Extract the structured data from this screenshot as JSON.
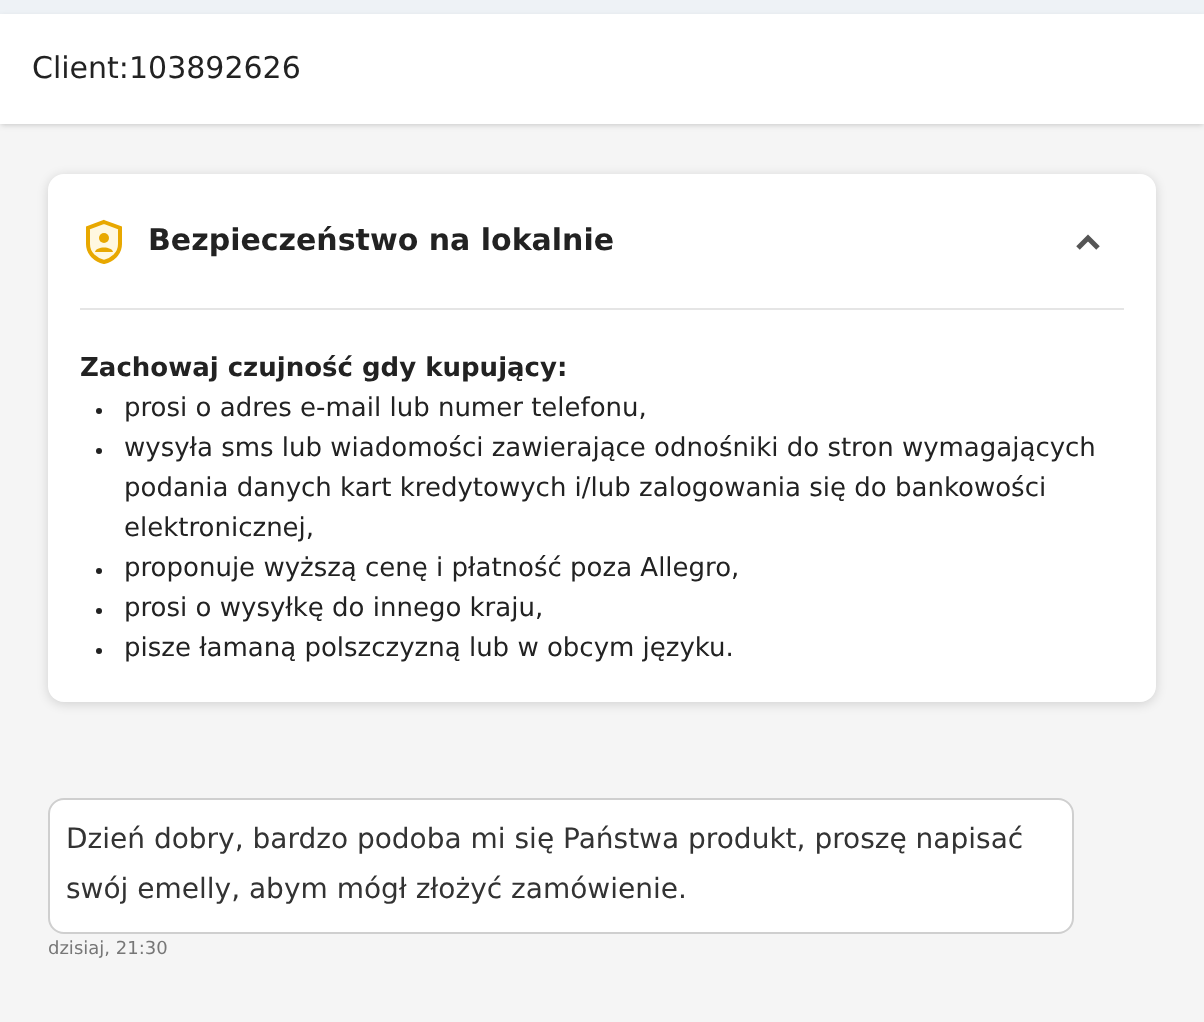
{
  "header": {
    "title": "Client:103892626"
  },
  "safety_panel": {
    "title": "Bezpieczeństwo na lokalnie",
    "expanded": true,
    "intro": "Zachowaj czujność gdy kupujący:",
    "items": [
      "prosi o adres e-mail lub numer telefonu,",
      "wysyła sms lub wiadomości zawierające odnośniki do stron wymagających podania danych kart kredytowych i/lub zalogowania się do bankowości elektronicznej,",
      "proponuje wyższą cenę i płatność poza Allegro,",
      "prosi o wysyłkę do innego kraju,",
      "pisze łamaną polszczyzną lub w obcym języku."
    ]
  },
  "messages": [
    {
      "text": "Dzień dobry, bardzo podoba mi się Państwa produkt, proszę napisać swój emelly, abym mógł złożyć zamówienie.",
      "time": "dzisiaj, 21:30"
    }
  ]
}
